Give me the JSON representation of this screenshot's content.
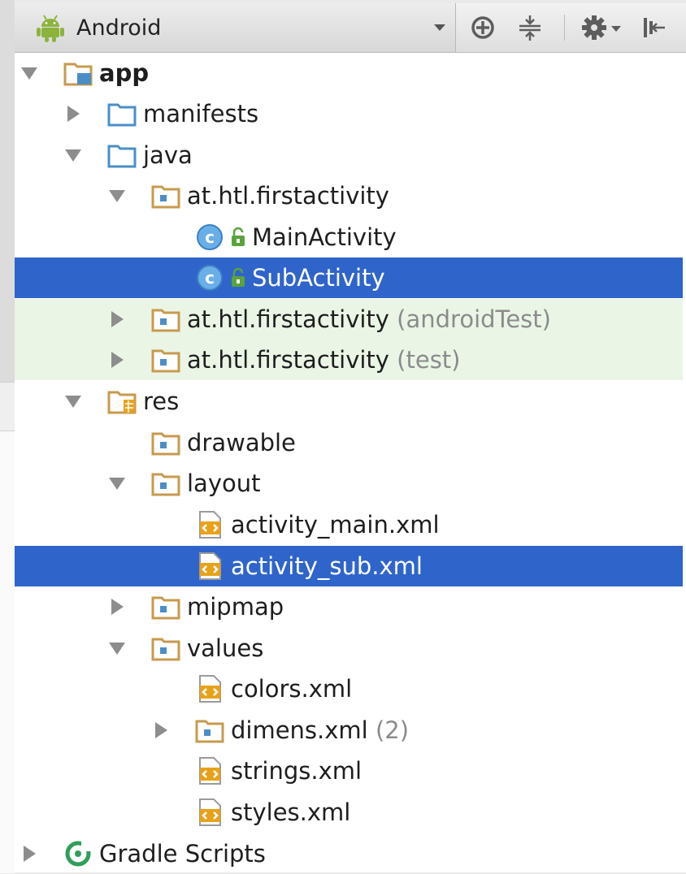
{
  "toolbar": {
    "view_label": "Android",
    "view_icon": "android-robot-icon",
    "buttons": [
      "locate-target-icon",
      "collapse-all-icon",
      "settings-gear-icon",
      "hide-panel-icon"
    ]
  },
  "colors": {
    "selection": "#2f65ca",
    "test_source_bg": "#eaf5e6",
    "folder": "#c79a4e",
    "blue_folder": "#4a8ec8",
    "class_icon": "#5aa7e6"
  },
  "tree": [
    {
      "label": "app",
      "suffix": "",
      "icon": "module-folder-icon",
      "expanded": true,
      "bold": true
    },
    {
      "label": "manifests",
      "suffix": "",
      "icon": "source-folder-icon",
      "expanded": false
    },
    {
      "label": "java",
      "suffix": "",
      "icon": "source-folder-icon",
      "expanded": true
    },
    {
      "label": "at.htl.firstactivity",
      "suffix": "",
      "icon": "package-folder-icon",
      "expanded": true
    },
    {
      "label": "MainActivity",
      "suffix": "",
      "icon": "class-icon",
      "leaf": true
    },
    {
      "label": "SubActivity",
      "suffix": "",
      "icon": "class-icon",
      "leaf": true,
      "selected": true
    },
    {
      "label": "at.htl.firstactivity",
      "suffix": "(androidTest)",
      "icon": "package-folder-icon",
      "expanded": false,
      "test": true
    },
    {
      "label": "at.htl.firstactivity",
      "suffix": "(test)",
      "icon": "package-folder-icon",
      "expanded": false,
      "test": true
    },
    {
      "label": "res",
      "suffix": "",
      "icon": "resource-folder-icon",
      "expanded": true
    },
    {
      "label": "drawable",
      "suffix": "",
      "icon": "package-folder-icon",
      "leaf": true
    },
    {
      "label": "layout",
      "suffix": "",
      "icon": "package-folder-icon",
      "expanded": true
    },
    {
      "label": "activity_main.xml",
      "suffix": "",
      "icon": "xml-file-icon",
      "leaf": true
    },
    {
      "label": "activity_sub.xml",
      "suffix": "",
      "icon": "xml-file-icon",
      "leaf": true,
      "selected": true
    },
    {
      "label": "mipmap",
      "suffix": "",
      "icon": "package-folder-icon",
      "expanded": false
    },
    {
      "label": "values",
      "suffix": "",
      "icon": "package-folder-icon",
      "expanded": true
    },
    {
      "label": "colors.xml",
      "suffix": "",
      "icon": "xml-file-icon",
      "leaf": true
    },
    {
      "label": "dimens.xml",
      "suffix": "(2)",
      "icon": "package-folder-icon",
      "expanded": false
    },
    {
      "label": "strings.xml",
      "suffix": "",
      "icon": "xml-file-icon",
      "leaf": true
    },
    {
      "label": "styles.xml",
      "suffix": "",
      "icon": "xml-file-icon",
      "leaf": true
    },
    {
      "label": "Gradle Scripts",
      "suffix": "",
      "icon": "gradle-icon",
      "expanded": false
    }
  ]
}
